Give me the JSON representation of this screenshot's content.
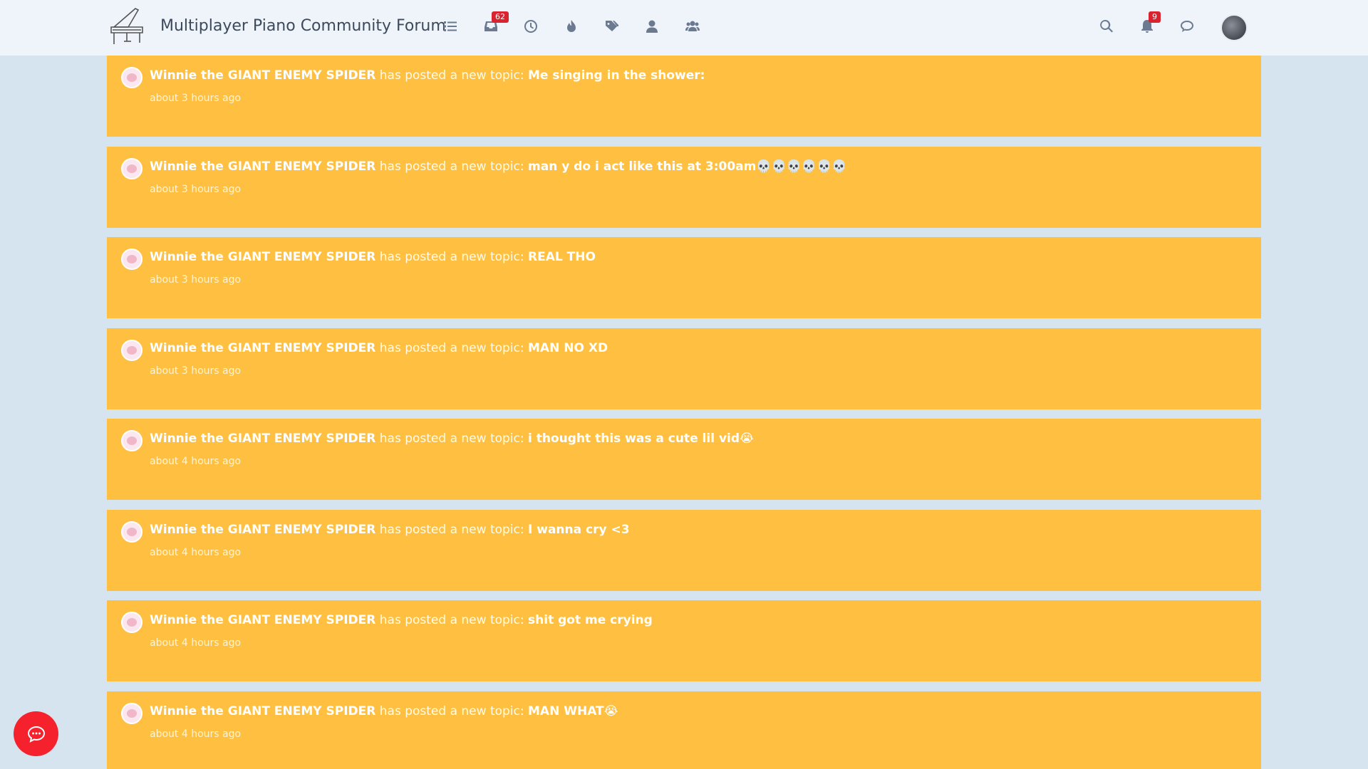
{
  "header": {
    "site_title": "Multiplayer Piano Community Forum",
    "nav_icons": [
      "list-icon",
      "inbox-icon",
      "clock-icon",
      "fire-icon",
      "tags-icon",
      "user-icon",
      "users-icon"
    ],
    "inbox_badge": "62",
    "notifications_badge": "9",
    "right_icons": [
      "search-icon",
      "bell-icon",
      "chat-icon"
    ]
  },
  "feed": {
    "items": [
      {
        "user": "Winnie the GIANT ENEMY SPIDER",
        "action": "has posted a new topic:",
        "topic": "Me singing in the shower:",
        "time": "about 3 hours ago"
      },
      {
        "user": "Winnie the GIANT ENEMY SPIDER",
        "action": "has posted a new topic:",
        "topic": "man y do i act like this at 3:00am💀💀💀💀💀💀",
        "time": "about 3 hours ago"
      },
      {
        "user": "Winnie the GIANT ENEMY SPIDER",
        "action": "has posted a new topic:",
        "topic": "REAL THO",
        "time": "about 3 hours ago"
      },
      {
        "user": "Winnie the GIANT ENEMY SPIDER",
        "action": "has posted a new topic:",
        "topic": "MAN NO XD",
        "time": "about 3 hours ago"
      },
      {
        "user": "Winnie the GIANT ENEMY SPIDER",
        "action": "has posted a new topic:",
        "topic": "i thought this was a cute lil vid😭",
        "time": "about 4 hours ago"
      },
      {
        "user": "Winnie the GIANT ENEMY SPIDER",
        "action": "has posted a new topic:",
        "topic": "I wanna cry <3",
        "time": "about 4 hours ago"
      },
      {
        "user": "Winnie the GIANT ENEMY SPIDER",
        "action": "has posted a new topic:",
        "topic": "shit got me crying",
        "time": "about 4 hours ago"
      },
      {
        "user": "Winnie the GIANT ENEMY SPIDER",
        "action": "has posted a new topic:",
        "topic": "MAN WHAT😭",
        "time": "about 4 hours ago"
      }
    ]
  },
  "colors": {
    "card_bg": "#ffc042",
    "page_bg": "#d6e4f0",
    "header_bg": "#eef4fa",
    "badge": "#d9232e",
    "fab": "#f5222d"
  }
}
